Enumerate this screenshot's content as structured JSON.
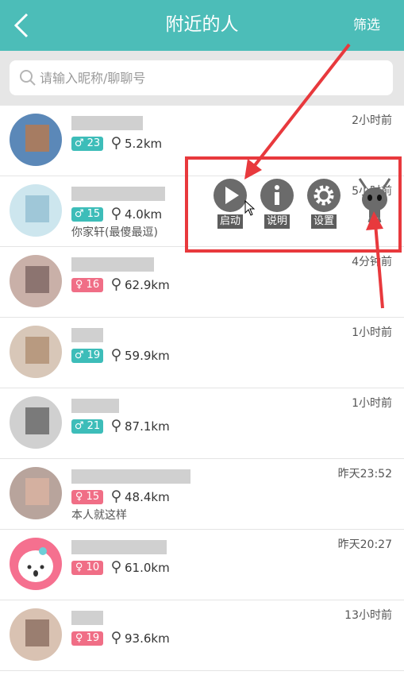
{
  "header": {
    "title": "附近的人",
    "filter_label": "筛选"
  },
  "search": {
    "placeholder": "请输入昵称/聊聊号"
  },
  "users": [
    {
      "gender": "male",
      "age": "♂ 23",
      "distance": "5.2km",
      "time": "2小时前",
      "signature": ""
    },
    {
      "gender": "male",
      "age": "♂ 15",
      "distance": "4.0km",
      "time": "5小时前",
      "signature": "你家轩(最傻最逗)"
    },
    {
      "gender": "female",
      "age": "♀ 16",
      "distance": "62.9km",
      "time": "4分钟前",
      "signature": ""
    },
    {
      "gender": "male",
      "age": "♂ 19",
      "distance": "59.9km",
      "time": "1小时前",
      "signature": ""
    },
    {
      "gender": "male",
      "age": "♂ 21",
      "distance": "87.1km",
      "time": "1小时前",
      "signature": ""
    },
    {
      "gender": "female",
      "age": "♀ 15",
      "distance": "48.4km",
      "time": "昨天23:52",
      "signature": "本人就这样"
    },
    {
      "gender": "female",
      "age": "♀ 10",
      "distance": "61.0km",
      "time": "昨天20:27",
      "signature": ""
    },
    {
      "gender": "female",
      "age": "♀ 19",
      "distance": "93.6km",
      "time": "13小时前",
      "signature": ""
    }
  ],
  "overlay": {
    "start_label": "启动",
    "info_label": "说明",
    "settings_label": "设置"
  },
  "colors": {
    "header": "#4cbdb8",
    "male": "#3dbdb9",
    "female": "#f06e86",
    "highlight": "#e8393d"
  }
}
